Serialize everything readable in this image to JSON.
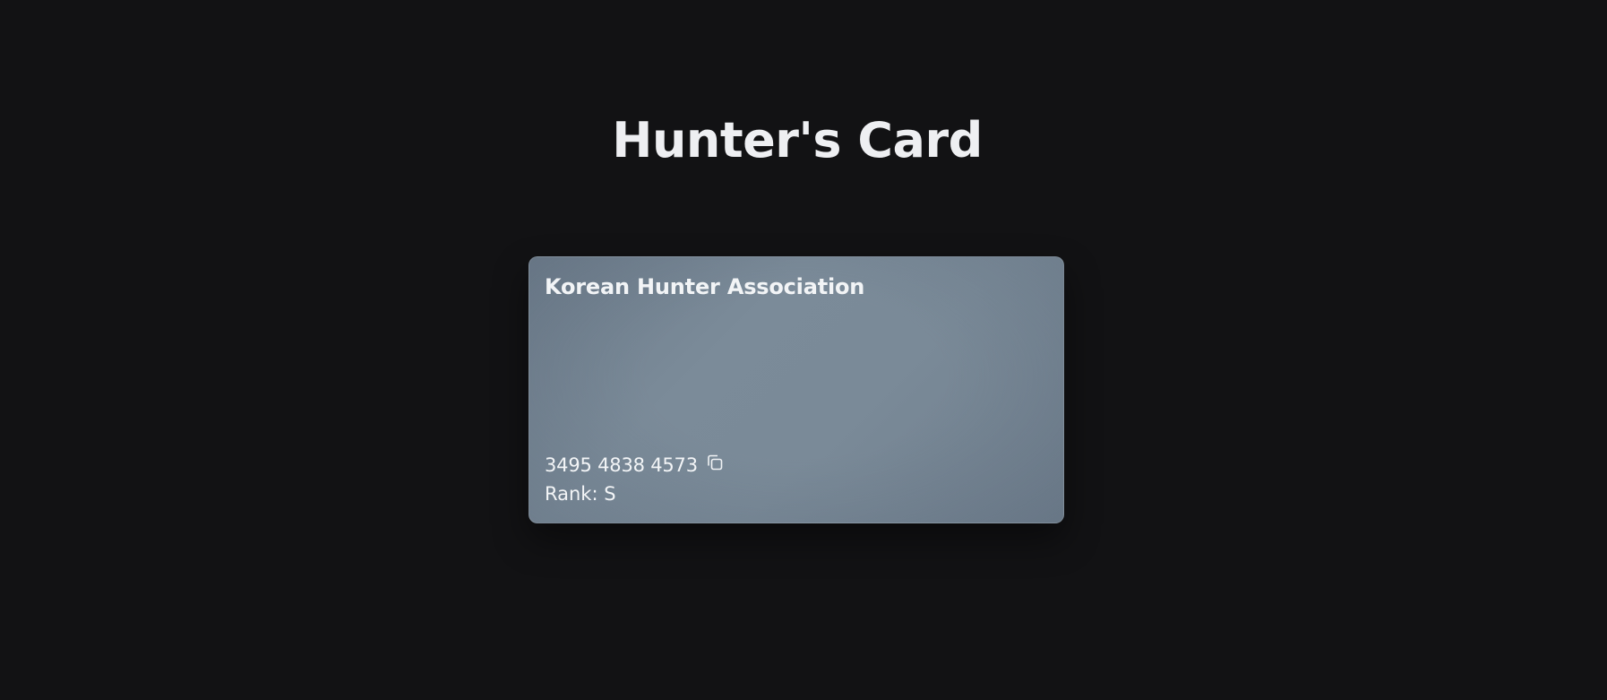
{
  "page": {
    "title": "Hunter's Card"
  },
  "card": {
    "issuer": "Korean Hunter Association",
    "number": "3495 4838 4573",
    "copy_icon": "copy-icon",
    "rank_text": "Rank: S"
  },
  "colors": {
    "background": "#121214",
    "card_base": "#7b8b99",
    "text": "#eef0f3"
  }
}
